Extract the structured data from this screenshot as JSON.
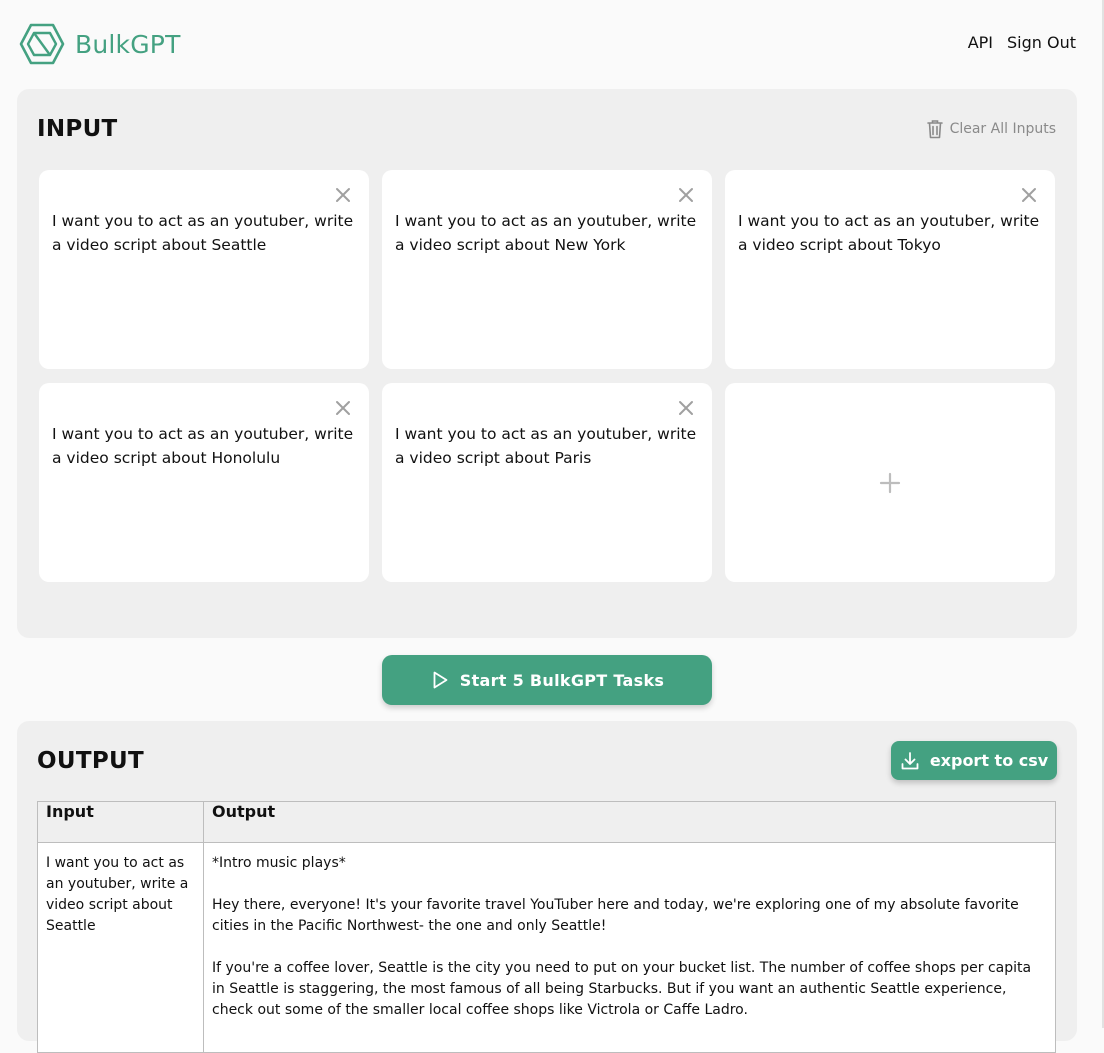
{
  "brand": {
    "name": "BulkGPT",
    "color": "#44a181"
  },
  "nav": {
    "api": "API",
    "sign_out": "Sign Out"
  },
  "input": {
    "title": "INPUT",
    "clear_label": "Clear All Inputs",
    "cards": [
      {
        "text": "I want you to act as an youtuber, write a video script about Seattle"
      },
      {
        "text": "I want you to act as an youtuber, write a video script about New York"
      },
      {
        "text": "I want you to act as an youtuber, write a video script about Tokyo"
      },
      {
        "text": "I want you to act as an youtuber, write a video script about Honolulu"
      },
      {
        "text": "I want you to act as an youtuber, write a video script about Paris"
      }
    ]
  },
  "start_button": {
    "label": "Start 5 BulkGPT Tasks"
  },
  "output": {
    "title": "OUTPUT",
    "export_label": "export to csv",
    "columns": [
      "Input",
      "Output"
    ],
    "rows": [
      {
        "input": "I want you to act as an youtuber, write a video script about Seattle",
        "output": [
          "*Intro music plays*",
          "Hey there, everyone! It's your favorite travel YouTuber here and today, we're exploring one of my absolute favorite cities in the Pacific Northwest- the one and only Seattle!",
          "If you're a coffee lover, Seattle is the city you need to put on your bucket list. The number of coffee shops per capita in Seattle is staggering, the most famous of all being Starbucks. But if you want an authentic Seattle experience, check out some of the smaller local coffee shops like Victrola or Caffe Ladro."
        ]
      }
    ]
  }
}
